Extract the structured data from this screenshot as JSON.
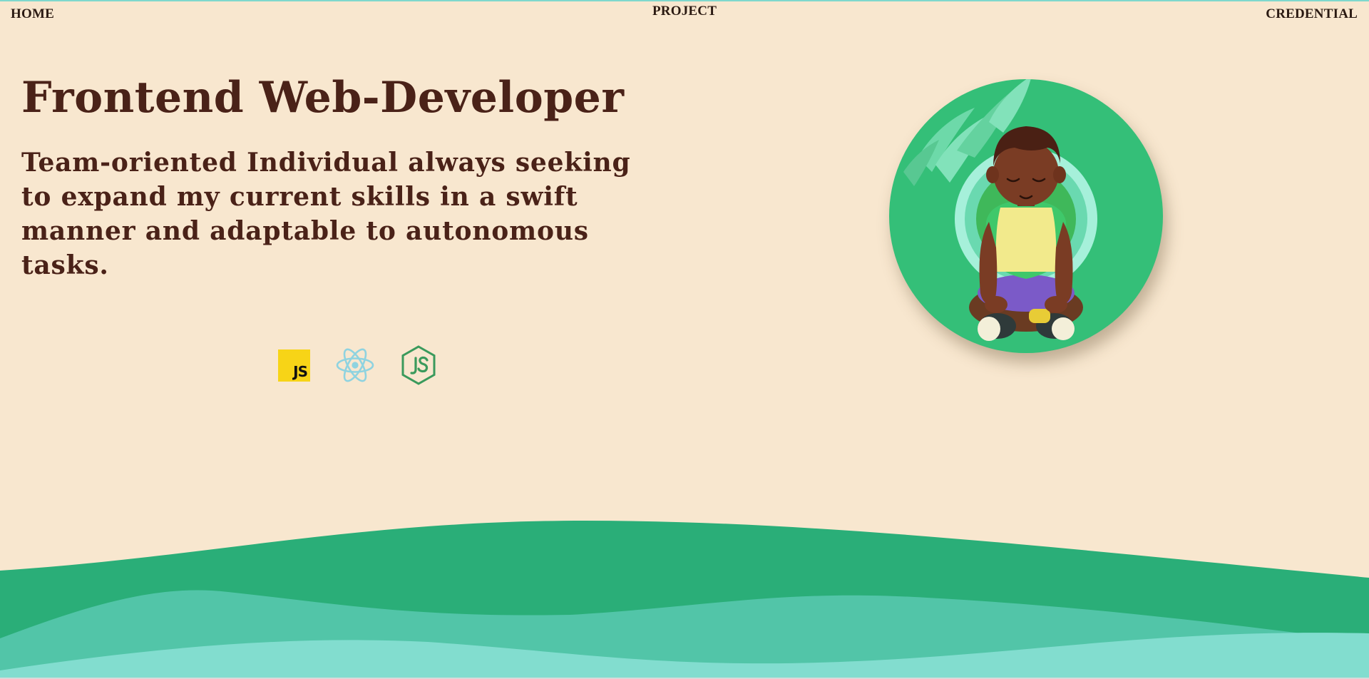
{
  "nav": {
    "home": "HOME",
    "project": "PROJECT",
    "credential": "CREDENTIAL"
  },
  "hero": {
    "title": "Frontend Web-Developer",
    "tagline": "Team-oriented Individual always seeking to expand my current skills in a swift manner and adaptable to autonomous tasks."
  },
  "skills": {
    "js_text": "JS",
    "icons": [
      "javascript-icon",
      "react-icon",
      "nodejs-icon"
    ]
  },
  "avatar": {
    "icon": "meditating-person-avatar"
  },
  "colors": {
    "background": "#f8e7cf",
    "text": "#4a2218",
    "wave_dark": "#2aae78",
    "wave_mid": "#52c5a8",
    "wave_light": "#82ddcf",
    "avatar_bg": "#34bf78"
  }
}
